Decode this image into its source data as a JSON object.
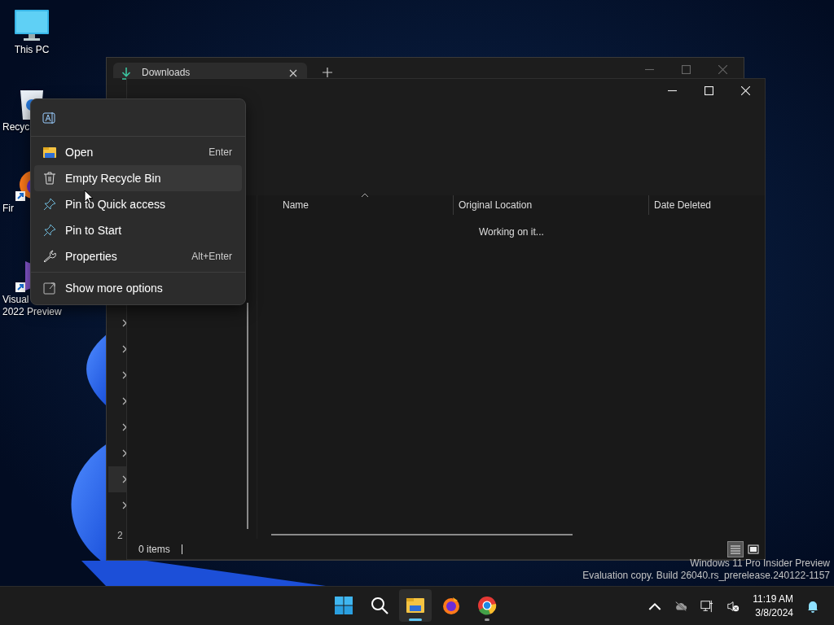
{
  "desktop_icons": [
    {
      "kind": "pc",
      "lines": [
        "This PC"
      ]
    },
    {
      "kind": "bin",
      "lines": [
        "Recyc"
      ]
    },
    {
      "kind": "firefox",
      "lines": [
        "Fir"
      ]
    },
    {
      "kind": "vs",
      "lines": [
        "Visual",
        "2022 Preview"
      ]
    }
  ],
  "back_window": {
    "tabs": [
      {
        "title": "Downloads",
        "selected": true
      }
    ],
    "nav_rows": [
      {
        "selected": false
      },
      {
        "selected": false
      },
      {
        "selected": false
      },
      {
        "selected": false
      },
      {
        "selected": false
      },
      {
        "selected": false
      },
      {
        "selected": true
      },
      {
        "selected": false
      }
    ],
    "status": "2"
  },
  "front_window": {
    "columns": [
      {
        "label": "Name",
        "sorted": true
      },
      {
        "label": "Original Location",
        "sorted": false
      },
      {
        "label": "Date Deleted",
        "sorted": false
      }
    ],
    "message": "Working on it...",
    "status": "0 items",
    "view_modes": [
      {
        "kind": "details",
        "selected": true
      },
      {
        "kind": "preview",
        "selected": false
      }
    ]
  },
  "context_menu": {
    "items": [
      {
        "kind": "open",
        "label": "Open",
        "shortcut": "Enter",
        "hovered": false
      },
      {
        "kind": "trash",
        "label": "Empty Recycle Bin",
        "hovered": true
      },
      {
        "kind": "pin",
        "label": "Pin to Quick access",
        "hovered": false
      },
      {
        "kind": "pin",
        "label": "Pin to Start",
        "hovered": false
      },
      {
        "kind": "wrench",
        "label": "Properties",
        "shortcut": "Alt+Enter",
        "hovered": false
      }
    ],
    "footer": {
      "label": "Show more options"
    }
  },
  "watermark": [
    "Windows 11 Pro Insider Preview",
    "Evaluation copy. Build 26040.rs_prerelease.240122-1157"
  ],
  "taskbar": {
    "apps": [
      {
        "kind": "start",
        "active": false,
        "running": false
      },
      {
        "kind": "search",
        "active": false,
        "running": false
      },
      {
        "kind": "explorer",
        "active": true,
        "running": true
      },
      {
        "kind": "firefox",
        "active": false,
        "running": false
      },
      {
        "kind": "chrome",
        "active": false,
        "running": true
      }
    ],
    "time": "11:19 AM",
    "date": "3/8/2024"
  }
}
